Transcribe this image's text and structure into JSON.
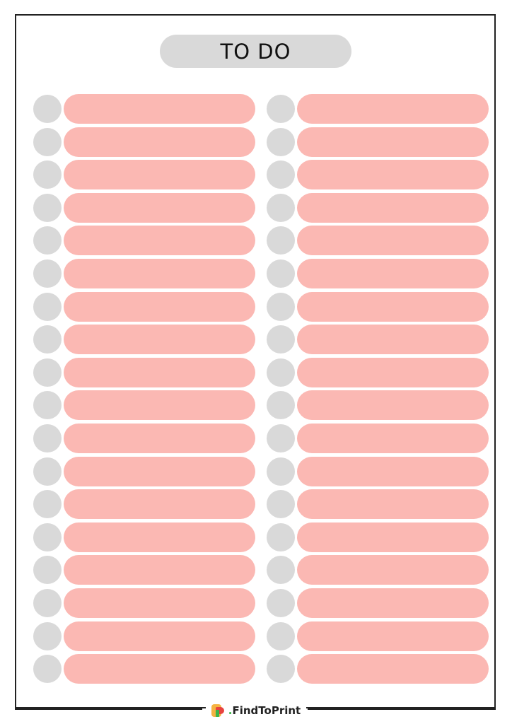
{
  "title": "TO DO",
  "colors": {
    "checkbox": "#d9d9d9",
    "line": "#fbb8b3",
    "title_bg": "#d9d9d9"
  },
  "columns": [
    {
      "name": "left",
      "rows": 18
    },
    {
      "name": "right",
      "rows": 18
    }
  ],
  "footer": {
    "brand_prefix": ".",
    "brand": "FindToPrint"
  }
}
